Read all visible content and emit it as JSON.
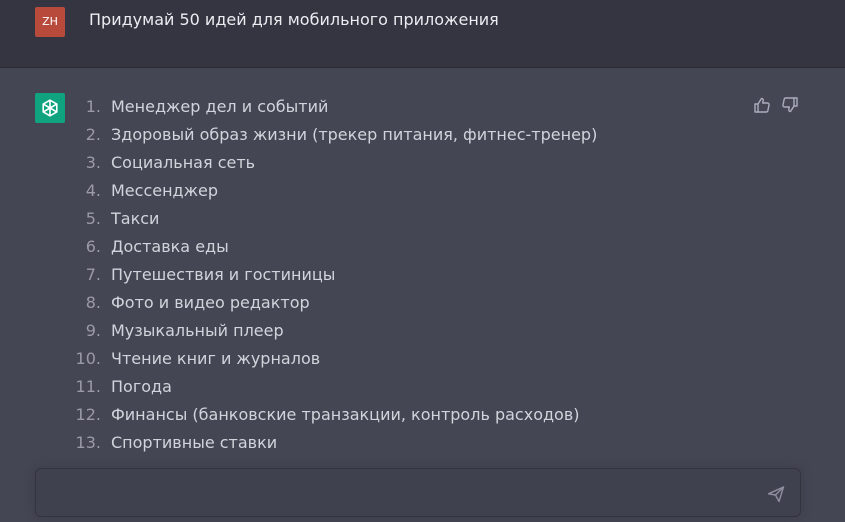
{
  "user": {
    "avatar_initials": "ZH",
    "avatar_color": "#b84a3c",
    "message": "Придумай 50 идей для мобильного приложения"
  },
  "assistant": {
    "avatar_icon": "openai-logo-icon",
    "avatar_color": "#10a37f",
    "ideas": [
      {
        "num": "1.",
        "text": "Менеджер дел и событий"
      },
      {
        "num": "2.",
        "text": "Здоровый образ жизни (трекер питания, фитнес-тренер)"
      },
      {
        "num": "3.",
        "text": "Социальная сеть"
      },
      {
        "num": "4.",
        "text": "Мессенджер"
      },
      {
        "num": "5.",
        "text": "Такси"
      },
      {
        "num": "6.",
        "text": "Доставка еды"
      },
      {
        "num": "7.",
        "text": "Путешествия и гостиницы"
      },
      {
        "num": "8.",
        "text": "Фото и видео редактор"
      },
      {
        "num": "9.",
        "text": "Музыкальный плеер"
      },
      {
        "num": "10.",
        "text": "Чтение книг и журналов"
      },
      {
        "num": "11.",
        "text": "Погода"
      },
      {
        "num": "12.",
        "text": "Финансы (банковские транзакции, контроль расходов)"
      },
      {
        "num": "13.",
        "text": "Спортивные ставки"
      }
    ],
    "feedback_icons": [
      "thumbs-up-icon",
      "thumbs-down-icon"
    ]
  },
  "composer": {
    "value": "",
    "send_icon": "send-icon"
  }
}
